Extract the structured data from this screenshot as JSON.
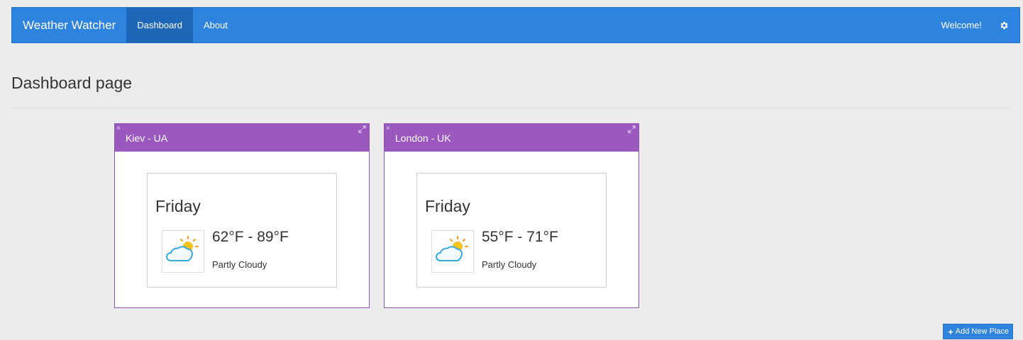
{
  "navbar": {
    "brand": "Weather Watcher",
    "items": [
      {
        "label": "Dashboard"
      },
      {
        "label": "About"
      }
    ],
    "welcome": "Welcome!",
    "settings_icon": "gear-icon"
  },
  "main": {
    "title": "Dashboard page"
  },
  "cards": [
    {
      "location": "Kiev - UA",
      "day": "Friday",
      "temp_range": "62°F - 89°F",
      "condition": "Partly Cloudy",
      "icon": "partly-cloudy-icon"
    },
    {
      "location": "London - UK",
      "day": "Friday",
      "temp_range": "55°F - 71°F",
      "condition": "Partly Cloudy",
      "icon": "partly-cloudy-icon"
    }
  ],
  "actions": {
    "add_place": "Add New Place",
    "add_icon": "plus-icon"
  },
  "colors": {
    "primary": "#2e83df",
    "card_header": "#9b59bf",
    "background": "#ececec"
  }
}
